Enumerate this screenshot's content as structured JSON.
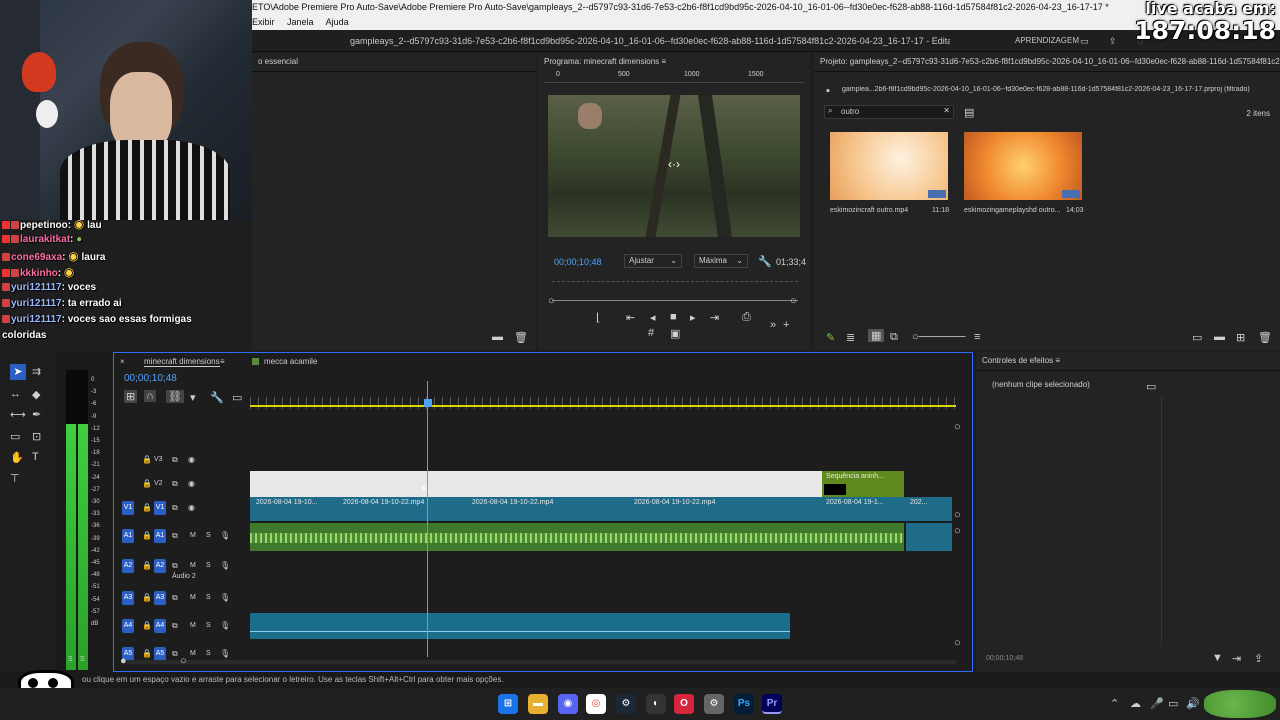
{
  "window": {
    "title": "ETO\\Adobe Premiere Pro Auto-Save\\Adobe Premiere Pro Auto-Save\\gampleays_2--d5797c93-31d6-7e53-c2b6-f8f1cd9bd95c-2026-04-10_16-01-06--fd30e0ec-f628-ab88-116d-1d57584f81c2-2026-04-23_16-17-17 *",
    "menu": [
      "Exibir",
      "Janela",
      "Ajuda"
    ],
    "doc_title": "gampleays_2--d5797c93-31d6-7e53-c2b6-f8f1cd9bd95c-2026-04-10_16-01-06--fd30e0ec-f628-ab88-116d-1d57584f81c2-2026-04-23_16-17-17 - Editado",
    "learning_label": "APRENDIZAGEM"
  },
  "overlay": {
    "line1": "live acaba em:",
    "line2": "187:08:18"
  },
  "chat": [
    {
      "user": "pepetinoo",
      "msg": "lau",
      "color": "#ffffff"
    },
    {
      "user": "laurakitkat",
      "msg": "",
      "color": "#ff6ea8"
    },
    {
      "user": "cone69axa",
      "msg": "laura",
      "color": "#ff6ea8"
    },
    {
      "user": "kkkinho",
      "msg": "",
      "color": "#ff6ea8"
    },
    {
      "user": "yuri121117",
      "msg": "voces",
      "color": "#9ab8ff"
    },
    {
      "user": "yuri121117",
      "msg": "ta errado ai",
      "color": "#9ab8ff"
    },
    {
      "user": "yuri121117",
      "msg": "voces sao essas formigas",
      "color": "#9ab8ff"
    }
  ],
  "chat_continuation": "coloridas",
  "left_panel": {
    "tab": "o essencial"
  },
  "program": {
    "tab": "Programa: minecraft dimensions",
    "ruler": [
      "0",
      "500",
      "1000",
      "1500"
    ],
    "timecode": "00;00;10;48",
    "fit": "Ajustar",
    "quality": "Máxima",
    "duration": "01;33;4"
  },
  "project": {
    "title": "Projeto: gampleays_2--d5797c93-31d6-7e53-c2b6-f8f1cd9bd95c-2026-04-10_16-01-06--fd30e0ec-f628-ab88-116d-1d57584f81c2-2026-04-23_16-17-17",
    "path": "gamplea...2b6-f8f1cd9bd95c-2026-04-10_16-01-06--fd30e0ec-f628-ab88-116d-1d57584f81c2-2026-04-23_16-17-17.prproj (filtrado)",
    "search": "outro",
    "count": "2 itens",
    "items": [
      {
        "name": "eskimozincraft outro.mp4",
        "duration": "11:18"
      },
      {
        "name": "eskimozingameplayshd outro...",
        "duration": "14;03"
      }
    ]
  },
  "timeline": {
    "tabs": [
      "minecraft dimensions",
      "mecca acamile"
    ],
    "timecode": "00;00;10;48",
    "tracks": [
      "V3",
      "V2",
      "V1",
      "A1",
      "A2",
      "A3",
      "A4",
      "A5"
    ],
    "audio2_name": "Áudio 2",
    "clips_v1": [
      "2026-08-04 19-10...",
      "2026-08-04 19-10-22.mp4",
      "2026-08-04 19-10-22.mp4",
      "2026-08-04 19-10-22.mp4",
      "2026-08-04 19-1...",
      "202..."
    ],
    "nested": "Sequência aninh...",
    "meter_scale": [
      "0",
      "-3",
      "-6",
      "-9",
      "-12",
      "-15",
      "-18",
      "-21",
      "-24",
      "-27",
      "-30",
      "-33",
      "-36",
      "-39",
      "-42",
      "-45",
      "-48",
      "-51",
      "-54",
      "-57",
      "dB"
    ],
    "meter_footer": [
      "S",
      "S"
    ]
  },
  "effects": {
    "tab": "Controles de efeitos",
    "empty": "(nenhum clipe selecionado)",
    "timecode": "00;00;10;48"
  },
  "status": "ou clique em um espaço vazio e arraste para selecionar o letreiro. Use as teclas Shift+Alt+Ctrl para obter mais opções.",
  "taskbar": {
    "apps": [
      "windows-icon",
      "folder-icon",
      "discord-icon",
      "chrome-icon",
      "steam-icon",
      "obs-icon",
      "opera-icon",
      "settings-icon",
      "photoshop-icon",
      "premiere-icon"
    ],
    "ps_label": "Ps",
    "pr_label": "Pr"
  }
}
